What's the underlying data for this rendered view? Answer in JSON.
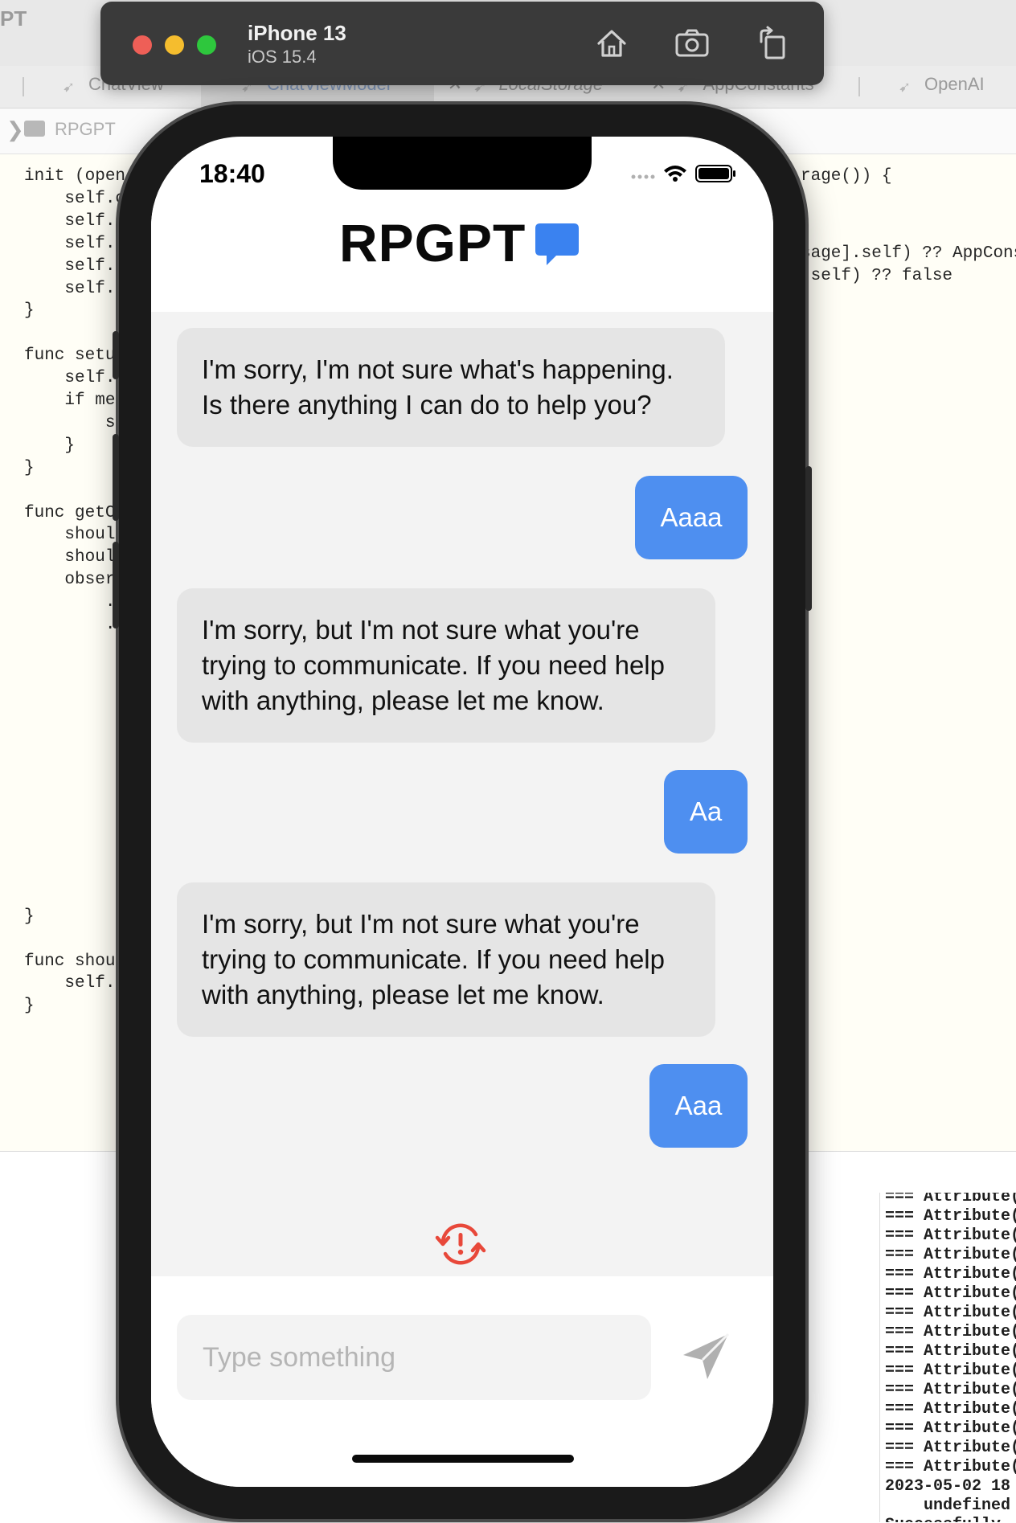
{
  "xcode": {
    "app_title": "PT",
    "tabs": [
      {
        "label": "ChatView"
      },
      {
        "label": "ChatViewModel"
      },
      {
        "label": "LocalStorage"
      },
      {
        "label": "AppConstants"
      },
      {
        "label": "OpenAI"
      }
    ],
    "path_project": "RPGPT",
    "code_left": [
      "init (open",
      "    self.c",
      "    self.l",
      "    self.m",
      "    self.s",
      "    self.s",
      "}",
      "",
      "func setu",
      "    self.c",
      "    if mes",
      "        se",
      "    }",
      "}",
      "",
      "func getC",
      "    shoul",
      "    should",
      "    obser",
      "        .",
      "        .",
      "",
      "",
      "",
      "",
      "",
      "",
      "",
      "",
      "",
      "          }",
      "",
      "          }",
      "}",
      "",
      "func shoul",
      "    self.s",
      "}"
    ],
    "code_right": [
      "rage()) {",
      "",
      "",
      "sage].self) ?? AppCons",
      " self) ?? false"
    ],
    "console_lines": [
      "=== Attribute(",
      "=== Attribute(",
      "=== Attribute(",
      "=== Attribute(",
      "=== Attribute(",
      "=== Attribute(",
      "=== Attribute(",
      "=== Attribute(",
      "=== Attribute(",
      "=== Attribute(",
      "=== Attribute(",
      "=== Attribute(",
      "=== Attribute(",
      "=== Attribute(",
      "=== Attribute(",
      "2023-05-02 18",
      "    undefined",
      "Successfully"
    ]
  },
  "simulator": {
    "device_name": "iPhone 13",
    "os_version": "iOS 15.4",
    "buttons": [
      "home-icon",
      "screenshot-icon",
      "rotate-icon"
    ]
  },
  "phone": {
    "status_time": "18:40",
    "app_title": "RPGPT",
    "messages": [
      {
        "role": "bot",
        "text": "I'm sorry, I'm not sure what's happening. Is there anything I can do to help you?"
      },
      {
        "role": "user",
        "text": "Aaaa"
      },
      {
        "role": "bot",
        "text": "I'm sorry, but I'm not sure what you're trying to communicate. If you need help with anything, please let me know."
      },
      {
        "role": "user",
        "text": "Aa"
      },
      {
        "role": "bot",
        "text": "I'm sorry, but I'm not sure what you're trying to communicate. If you need help with anything, please let me know."
      },
      {
        "role": "user",
        "text": "Aaa"
      }
    ],
    "input_placeholder": "Type something",
    "input_value": "",
    "colors": {
      "accent": "#4e8ff0",
      "bot_bubble": "#e5e5e5",
      "error": "#e8483a",
      "send_icon": "#b0b0b0"
    }
  }
}
